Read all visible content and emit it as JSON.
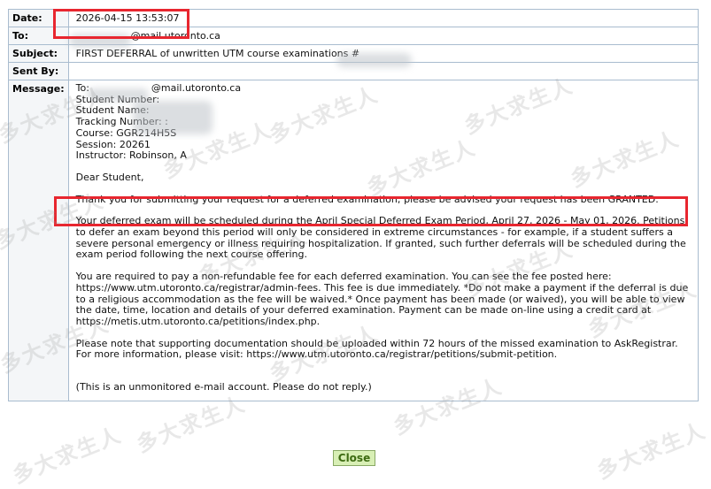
{
  "fields": {
    "date_label": "Date:",
    "date_value": "2026-04-15 13:53:07",
    "to_label": "To:",
    "to_value": "@mail.utoronto.ca",
    "subject_label": "Subject:",
    "subject_value": "FIRST DEFERRAL of unwritten UTM course examinations #",
    "sentby_label": "Sent By:",
    "sentby_value": "",
    "message_label": "Message:"
  },
  "message": {
    "header_lines": [
      "To:                    @mail.utoronto.ca",
      "Student Number:",
      "Student Name:",
      "Tracking Number: :",
      "Course: GGR214H5S",
      "Session: 20261",
      "Instructor: Robinson, A"
    ],
    "greeting": "Dear Student,",
    "para1": "Thank you for submitting your request for a deferred examination; please be advised your request has been GRANTED.",
    "para2": "Your deferred exam will be scheduled during the April Special Deferred Exam Period, April 27, 2026 - May 01, 2026. Petitions to defer an exam beyond this period will only be considered in extreme circumstances - for example, if a student suffers a severe personal emergency or illness requiring hospitalization. If granted, such further deferrals will be scheduled during the exam period following the next course offering.",
    "para3": "You are required to pay a non-refundable fee for each deferred examination. You can see the fee posted here: https://www.utm.utoronto.ca/registrar/admin-fees. This fee is due immediately. *Do not make a payment if the deferral is due to a religious accommodation as the fee will be waived.* Once payment has been made (or waived), you will be able to view the date, time, location and details of your deferred examination. Payment can be made on-line using a credit card at https://metis.utm.utoronto.ca/petitions/index.php.",
    "para4": "Please note that supporting documentation should be uploaded within 72 hours of the missed examination to AskRegistrar. For more information, please visit: https://www.utm.utoronto.ca/registrar/petitions/submit-petition.",
    "footer": "(This is an unmonitored e-mail account. Please do not reply.)"
  },
  "buttons": {
    "close_label": "Close"
  },
  "watermark": {
    "text": "多大求生人"
  },
  "colors": {
    "highlight_box": "#e8262f",
    "border": "#a9bccf",
    "button_bg": "#d8efb5",
    "button_text": "#3d6b12"
  }
}
